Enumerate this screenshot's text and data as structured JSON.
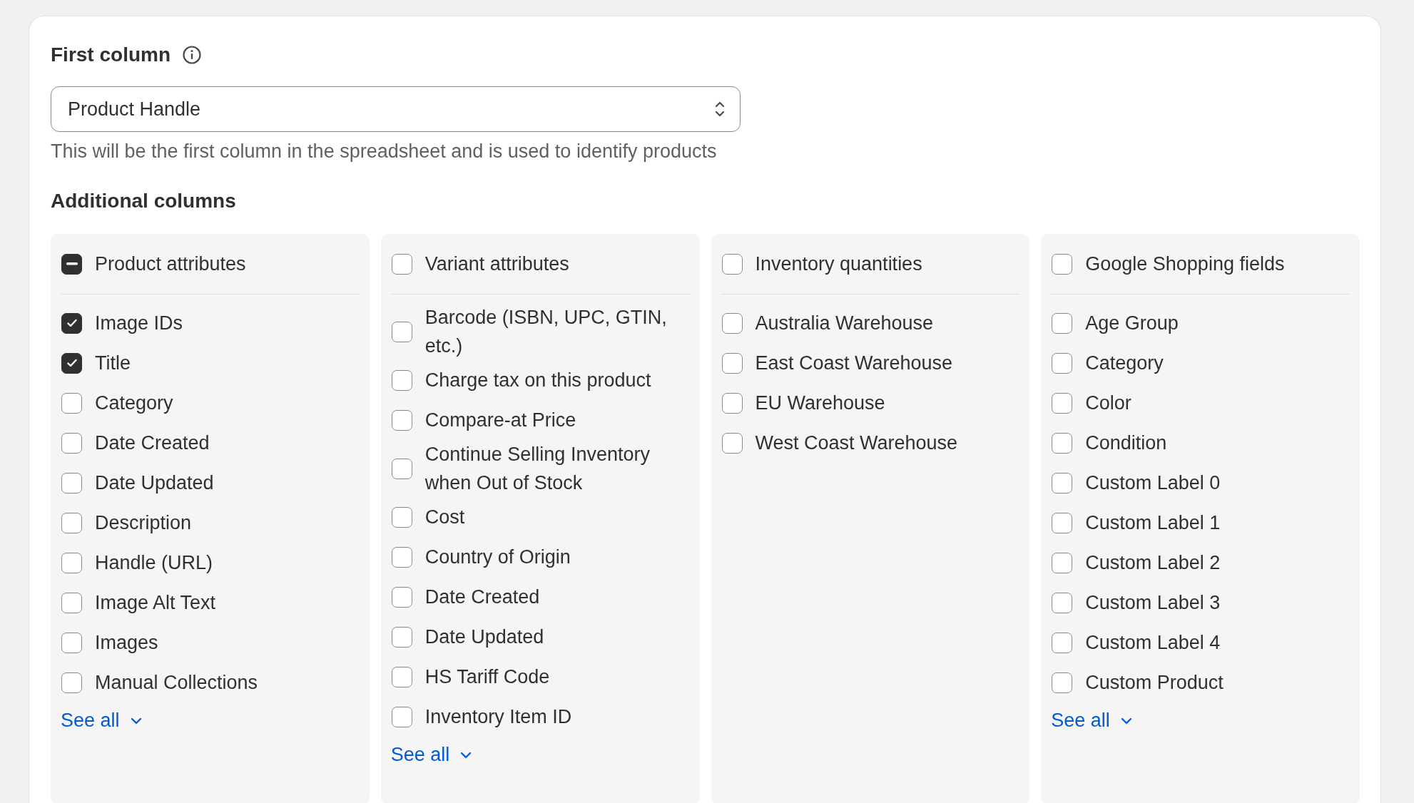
{
  "first_column": {
    "title": "First column",
    "select": {
      "value": "Product Handle"
    },
    "help": "This will be the first column in the spreadsheet and is used to identify products"
  },
  "additional_columns": {
    "title": "Additional columns",
    "groups": [
      {
        "label": "Product attributes",
        "checked": true,
        "indeterminate": true,
        "items": [
          {
            "label": "Image IDs",
            "checked": true
          },
          {
            "label": "Title",
            "checked": true
          },
          {
            "label": "Category",
            "checked": false
          },
          {
            "label": "Date Created",
            "checked": false
          },
          {
            "label": "Date Updated",
            "checked": false
          },
          {
            "label": "Description",
            "checked": false
          },
          {
            "label": "Handle (URL)",
            "checked": false
          },
          {
            "label": "Image Alt Text",
            "checked": false
          },
          {
            "label": "Images",
            "checked": false
          },
          {
            "label": "Manual Collections",
            "checked": false
          }
        ],
        "see_all": "See all"
      },
      {
        "label": "Variant attributes",
        "checked": false,
        "indeterminate": false,
        "items": [
          {
            "label": "Barcode (ISBN, UPC, GTIN, etc.)",
            "checked": false
          },
          {
            "label": "Charge tax on this product",
            "checked": false
          },
          {
            "label": "Compare-at Price",
            "checked": false
          },
          {
            "label": "Continue Selling Inventory when Out of Stock",
            "checked": false
          },
          {
            "label": "Cost",
            "checked": false
          },
          {
            "label": "Country of Origin",
            "checked": false
          },
          {
            "label": "Date Created",
            "checked": false
          },
          {
            "label": "Date Updated",
            "checked": false
          },
          {
            "label": "HS Tariff Code",
            "checked": false
          },
          {
            "label": "Inventory Item ID",
            "checked": false
          }
        ],
        "see_all": "See all"
      },
      {
        "label": "Inventory quantities",
        "checked": false,
        "indeterminate": false,
        "items": [
          {
            "label": "Australia Warehouse",
            "checked": false
          },
          {
            "label": "East Coast Warehouse",
            "checked": false
          },
          {
            "label": "EU Warehouse",
            "checked": false
          },
          {
            "label": "West Coast Warehouse",
            "checked": false
          }
        ]
      },
      {
        "label": "Google Shopping fields",
        "checked": false,
        "indeterminate": false,
        "items": [
          {
            "label": "Age Group",
            "checked": false
          },
          {
            "label": "Category",
            "checked": false
          },
          {
            "label": "Color",
            "checked": false
          },
          {
            "label": "Condition",
            "checked": false
          },
          {
            "label": "Custom Label 0",
            "checked": false
          },
          {
            "label": "Custom Label 1",
            "checked": false
          },
          {
            "label": "Custom Label 2",
            "checked": false
          },
          {
            "label": "Custom Label 3",
            "checked": false
          },
          {
            "label": "Custom Label 4",
            "checked": false
          },
          {
            "label": "Custom Product",
            "checked": false
          }
        ],
        "see_all": "See all"
      }
    ]
  }
}
